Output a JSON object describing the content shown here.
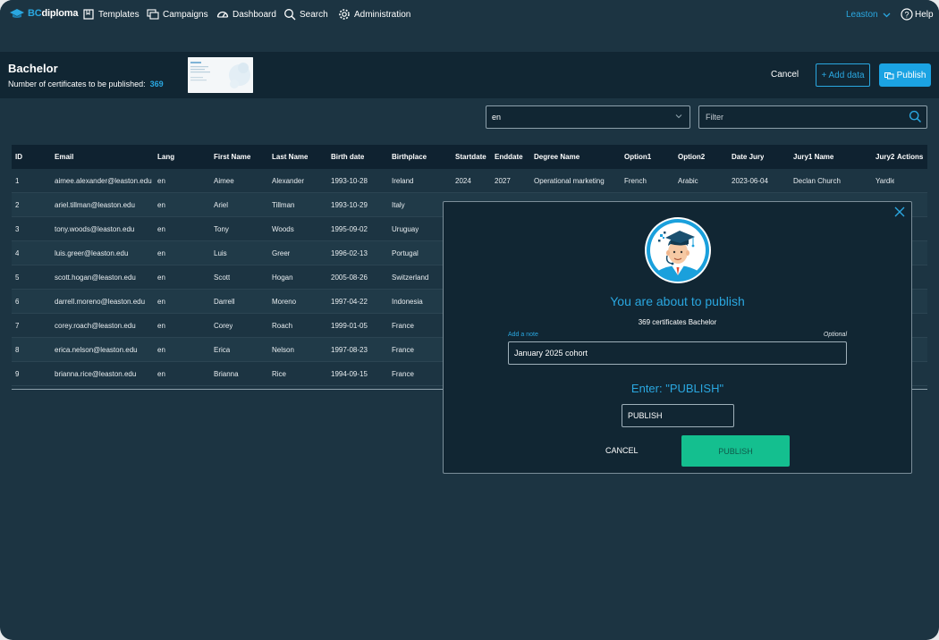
{
  "nav": {
    "logo_prefix": "BC",
    "logo_suffix": "diploma",
    "items": [
      {
        "label": "Templates",
        "icon": "template-icon"
      },
      {
        "label": "Campaigns",
        "icon": "campaigns-icon"
      },
      {
        "label": "Dashboard",
        "icon": "dashboard-icon"
      },
      {
        "label": "Search",
        "icon": "search-icon"
      },
      {
        "label": "Administration",
        "icon": "gear-icon"
      }
    ],
    "org": "Leaston",
    "help": "Help"
  },
  "header": {
    "title": "Bachelor",
    "count_label": "Number of certificates to be published:",
    "count_value": "369",
    "cancel_label": "Cancel",
    "add_data_label": "+ Add data",
    "publish_label": "Publish"
  },
  "filters": {
    "lang_value": "en",
    "filter_placeholder": "Filter"
  },
  "table": {
    "columns": [
      "ID",
      "Email",
      "Lang",
      "First Name",
      "Last Name",
      "Birth date",
      "Birthplace",
      "Startdate",
      "Enddate",
      "Degree Name",
      "Option1",
      "Option2",
      "Date Jury",
      "Jury1 Name",
      "Jury2",
      "Actions"
    ],
    "rows": [
      [
        "1",
        "aimee.alexander@leaston.edu",
        "en",
        "Aimee",
        "Alexander",
        "1993-10-28",
        "Ireland",
        "2024",
        "2027",
        "Operational marketing",
        "French",
        "Arabic",
        "2023-06-04",
        "Declan Church",
        "Yardley"
      ],
      [
        "2",
        "ariel.tillman@leaston.edu",
        "en",
        "Ariel",
        "Tillman",
        "1993-10-29",
        "Italy"
      ],
      [
        "3",
        "tony.woods@leaston.edu",
        "en",
        "Tony",
        "Woods",
        "1995-09-02",
        "Uruguay"
      ],
      [
        "4",
        "luis.greer@leaston.edu",
        "en",
        "Luis",
        "Greer",
        "1996-02-13",
        "Portugal"
      ],
      [
        "5",
        "scott.hogan@leaston.edu",
        "en",
        "Scott",
        "Hogan",
        "2005-08-26",
        "Switzerland"
      ],
      [
        "6",
        "darrell.moreno@leaston.edu",
        "en",
        "Darrell",
        "Moreno",
        "1997-04-22",
        "Indonesia"
      ],
      [
        "7",
        "corey.roach@leaston.edu",
        "en",
        "Corey",
        "Roach",
        "1999-01-05",
        "France"
      ],
      [
        "8",
        "erica.nelson@leaston.edu",
        "en",
        "Erica",
        "Nelson",
        "1997-08-23",
        "France"
      ],
      [
        "9",
        "brianna.rice@leaston.edu",
        "en",
        "Brianna",
        "Rice",
        "1994-09-15",
        "France"
      ]
    ]
  },
  "modal": {
    "title": "You are about to publish",
    "subtitle": "369 certificates Bachelor",
    "note_label": "Add a note",
    "note_optional": "Optional",
    "note_value": "January 2025 cohort",
    "enter_label": "Enter: \"PUBLISH\"",
    "confirm_value": "PUBLISH",
    "cancel_label": "CANCEL",
    "publish_label": "PUBLISH"
  },
  "colors": {
    "accent": "#2aa7e0",
    "background": "#1c3442",
    "header_band": "#112633",
    "publish_green": "#14bf8f"
  }
}
